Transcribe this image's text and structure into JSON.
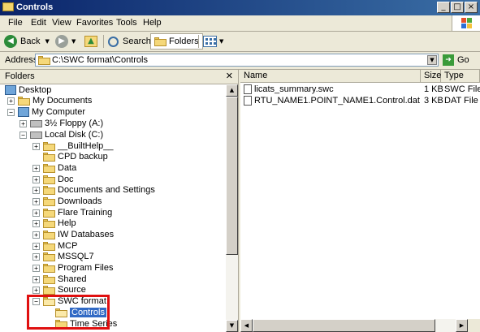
{
  "window": {
    "title": "Controls"
  },
  "menu": [
    {
      "label": "File"
    },
    {
      "label": "Edit"
    },
    {
      "label": "View"
    },
    {
      "label": "Favorites"
    },
    {
      "label": "Tools"
    },
    {
      "label": "Help"
    }
  ],
  "toolbar": {
    "back": "Back",
    "search": "Search",
    "folders": "Folders"
  },
  "address": {
    "label": "Address",
    "value": "C:\\SWC format\\Controls",
    "go": "Go"
  },
  "folders_pane": {
    "title": "Folders",
    "tree": [
      {
        "label": "Desktop",
        "icon": "desktop-icon"
      },
      {
        "label": "My Documents",
        "icon": "folder-icon"
      },
      {
        "label": "My Computer",
        "icon": "computer-icon"
      },
      {
        "label": "3½ Floppy (A:)",
        "icon": "floppy-icon"
      },
      {
        "label": "Local Disk (C:)",
        "icon": "drive-icon"
      },
      {
        "label": "__BuiltHelp__",
        "icon": "folder-icon"
      },
      {
        "label": "CPD backup",
        "icon": "folder-icon"
      },
      {
        "label": "Data",
        "icon": "folder-icon"
      },
      {
        "label": "Doc",
        "icon": "folder-icon"
      },
      {
        "label": "Documents and Settings",
        "icon": "folder-icon"
      },
      {
        "label": "Downloads",
        "icon": "folder-icon"
      },
      {
        "label": "Flare Training",
        "icon": "folder-icon"
      },
      {
        "label": "Help",
        "icon": "folder-icon"
      },
      {
        "label": "IW Databases",
        "icon": "folder-icon"
      },
      {
        "label": "MCP",
        "icon": "folder-icon"
      },
      {
        "label": "MSSQL7",
        "icon": "folder-icon"
      },
      {
        "label": "Program Files",
        "icon": "folder-icon"
      },
      {
        "label": "Shared",
        "icon": "folder-icon"
      },
      {
        "label": "Source",
        "icon": "folder-icon"
      },
      {
        "label": "SWC format",
        "icon": "folder-open-icon"
      },
      {
        "label": "Controls",
        "icon": "folder-open-icon",
        "selected": true
      },
      {
        "label": "Time Series",
        "icon": "folder-icon"
      }
    ]
  },
  "files_pane": {
    "columns": [
      "Name",
      "Size",
      "Type"
    ],
    "rows": [
      {
        "name": "licats_summary.swc",
        "size": "1 KB",
        "type": "SWC File"
      },
      {
        "name": "RTU_NAME1.POINT_NAME1.Control.dat",
        "size": "3 KB",
        "type": "DAT File"
      }
    ]
  },
  "colors": {
    "title_bar": "#0a246a",
    "selection": "#316ac5",
    "highlight_box": "#e01010"
  }
}
